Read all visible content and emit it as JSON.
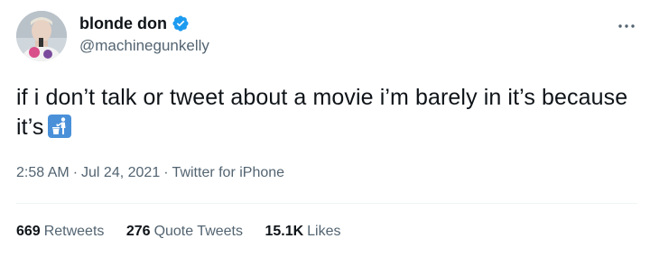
{
  "author": {
    "display_name": "blonde don",
    "handle": "@machinegunkelly",
    "verified": true
  },
  "tweet": {
    "text": "if i don’t talk or tweet about a movie i’m barely in it’s because it’s",
    "emoji": "put-litter-in-its-place"
  },
  "meta": {
    "time": "2:58 AM",
    "date": "Jul 24, 2021",
    "source": "Twitter for iPhone",
    "separator": "·"
  },
  "stats": {
    "retweets": {
      "count": "669",
      "label": "Retweets"
    },
    "quote_tweets": {
      "count": "276",
      "label": "Quote Tweets"
    },
    "likes": {
      "count": "15.1K",
      "label": "Likes"
    }
  },
  "colors": {
    "text_primary": "#0f1419",
    "text_secondary": "#536471",
    "verified_blue": "#1d9bf0",
    "emoji_blue": "#4a90d9"
  }
}
